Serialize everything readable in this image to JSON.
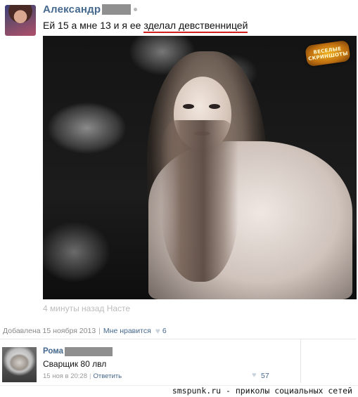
{
  "post": {
    "author_name": "Александр",
    "text_before": "Ей 15 а мне 13 и я ее ",
    "text_underlined": "зделал девственницей",
    "photo_caption": "4 минуты назад Насте",
    "watermark": "ВЕСЕЛЫЕ СКРИНШОТЫ"
  },
  "meta": {
    "added_label": "Добавлена",
    "added_date": "15 ноября 2013",
    "like_label": "Мне нравится",
    "like_count": "6"
  },
  "comment": {
    "author_name": "Рома",
    "text": "Сварщик 80 лвл",
    "date": "15 ноя в 20:28",
    "reply_label": "Ответить",
    "like_count": "57"
  },
  "footer": {
    "text": "smspunk.ru - приколы социальных сетей"
  },
  "colors": {
    "link": "#45688e",
    "underline": "#d02020",
    "redaction": "#8f8f8f"
  }
}
